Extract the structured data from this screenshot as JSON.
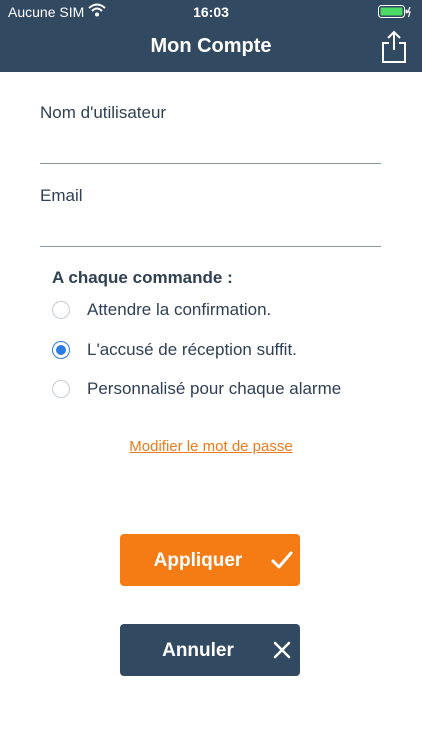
{
  "status_bar": {
    "carrier": "Aucune SIM",
    "time": "16:03"
  },
  "header": {
    "title": "Mon Compte"
  },
  "form": {
    "username_label": "Nom d'utilisateur",
    "username_value": "",
    "email_label": "Email",
    "email_value": ""
  },
  "order_section": {
    "title": "A chaque commande :",
    "options": [
      {
        "label": "Attendre la confirmation.",
        "selected": false
      },
      {
        "label": "L'accusé de réception suffit.",
        "selected": true
      },
      {
        "label": "Personnalisé pour chaque alarme",
        "selected": false
      }
    ]
  },
  "change_password_link": "Modifier le mot de passe",
  "buttons": {
    "apply_label": "Appliquer",
    "cancel_label": "Annuler"
  },
  "colors": {
    "header_bg": "#324962",
    "accent_orange": "#f57c14",
    "radio_selected": "#2c7be5",
    "text_dark": "#2f4054"
  },
  "icons": [
    "wifi-icon",
    "battery-icon",
    "share-icon",
    "checkmark-icon",
    "close-icon"
  ]
}
